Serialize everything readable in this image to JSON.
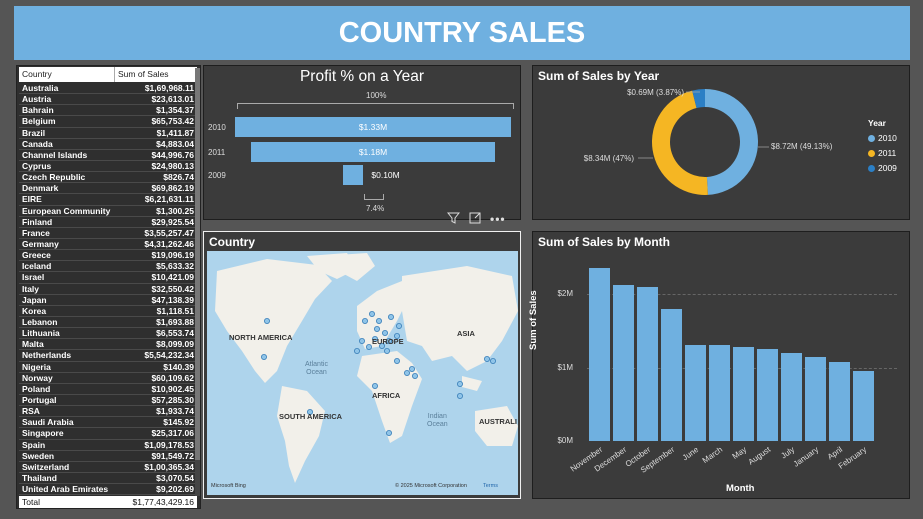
{
  "header": {
    "title": "COUNTRY SALES"
  },
  "table": {
    "col1": "Country",
    "col2": "Sum of Sales",
    "rows": [
      [
        "Australia",
        "$1,69,968.11"
      ],
      [
        "Austria",
        "$23,613.01"
      ],
      [
        "Bahrain",
        "$1,354.37"
      ],
      [
        "Belgium",
        "$65,753.42"
      ],
      [
        "Brazil",
        "$1,411.87"
      ],
      [
        "Canada",
        "$4,883.04"
      ],
      [
        "Channel Islands",
        "$44,996.76"
      ],
      [
        "Cyprus",
        "$24,980.13"
      ],
      [
        "Czech Republic",
        "$826.74"
      ],
      [
        "Denmark",
        "$69,862.19"
      ],
      [
        "EIRE",
        "$6,21,631.11"
      ],
      [
        "European Community",
        "$1,300.25"
      ],
      [
        "Finland",
        "$29,925.54"
      ],
      [
        "France",
        "$3,55,257.47"
      ],
      [
        "Germany",
        "$4,31,262.46"
      ],
      [
        "Greece",
        "$19,096.19"
      ],
      [
        "Iceland",
        "$5,633.32"
      ],
      [
        "Israel",
        "$10,421.09"
      ],
      [
        "Italy",
        "$32,550.42"
      ],
      [
        "Japan",
        "$47,138.39"
      ],
      [
        "Korea",
        "$1,118.51"
      ],
      [
        "Lebanon",
        "$1,693.88"
      ],
      [
        "Lithuania",
        "$6,553.74"
      ],
      [
        "Malta",
        "$8,099.09"
      ],
      [
        "Netherlands",
        "$5,54,232.34"
      ],
      [
        "Nigeria",
        "$140.39"
      ],
      [
        "Norway",
        "$60,109.62"
      ],
      [
        "Poland",
        "$10,902.45"
      ],
      [
        "Portugal",
        "$57,285.30"
      ],
      [
        "RSA",
        "$1,933.74"
      ],
      [
        "Saudi Arabia",
        "$145.92"
      ],
      [
        "Singapore",
        "$25,317.06"
      ],
      [
        "Spain",
        "$1,09,178.53"
      ],
      [
        "Sweden",
        "$91,549.72"
      ],
      [
        "Switzerland",
        "$1,00,365.34"
      ],
      [
        "Thailand",
        "$3,070.54"
      ],
      [
        "United Arab Emirates",
        "$9,202.69"
      ]
    ],
    "total_label": "Total",
    "total_value": "$1,77,43,429.16"
  },
  "map": {
    "title": "Country",
    "labels": {
      "na": "NORTH AMERICA",
      "eu": "EUROPE",
      "asia": "ASIA",
      "af": "AFRICA",
      "sa": "SOUTH AMERICA",
      "au": "AUSTRALI"
    },
    "oceans": {
      "atl1": "Atlantic",
      "atl2": "Ocean",
      "ind1": "Indian",
      "ind2": "Ocean"
    },
    "bing": "Microsoft Bing",
    "copyright": "© 2025 Microsoft Corporation",
    "terms": "Terms",
    "colors": {
      "water": "#aed4ec",
      "land": "#f2f0ea",
      "dot": "#5ea2d4"
    }
  },
  "icons": [
    "filter-icon",
    "expand-icon",
    "more-options-icon"
  ],
  "chart_data": [
    {
      "type": "bar",
      "orientation": "horizontal-funnel",
      "title": "Profit % on a Year",
      "categories": [
        "2010",
        "2011",
        "2009"
      ],
      "values": [
        1.33,
        1.18,
        0.1
      ],
      "value_labels": [
        "$1.33M",
        "$1.18M",
        "$0.10M"
      ],
      "top_pct": "100%",
      "bottom_pct": "7.4%",
      "color": "#6fb0e0"
    },
    {
      "type": "pie",
      "variant": "donut",
      "title": "Sum of Sales by Year",
      "legend_title": "Year",
      "legend_position": "right",
      "series": [
        {
          "name": "2010",
          "value": 8.72,
          "pct": 49.13,
          "label": "$8.72M (49.13%)",
          "color": "#6fb0e0"
        },
        {
          "name": "2011",
          "value": 8.34,
          "pct": 47,
          "label": "$8.34M (47%)",
          "color": "#f5b623"
        },
        {
          "name": "2009",
          "value": 0.69,
          "pct": 3.87,
          "label": "$0.69M (3.87%)",
          "color": "#2b7fc5"
        }
      ]
    },
    {
      "type": "bar",
      "title": "Sum of Sales by Month",
      "xlabel": "Month",
      "ylabel": "Sum of Sales",
      "categories": [
        "November",
        "December",
        "October",
        "September",
        "June",
        "March",
        "May",
        "August",
        "July",
        "January",
        "April",
        "February"
      ],
      "values": [
        2.35,
        2.12,
        2.09,
        1.8,
        1.31,
        1.3,
        1.28,
        1.25,
        1.2,
        1.14,
        1.07,
        0.95
      ],
      "yticks": [
        "$0M",
        "$1M",
        "$2M"
      ],
      "ylim": [
        0,
        2.5
      ],
      "color": "#6fb0e0"
    }
  ]
}
